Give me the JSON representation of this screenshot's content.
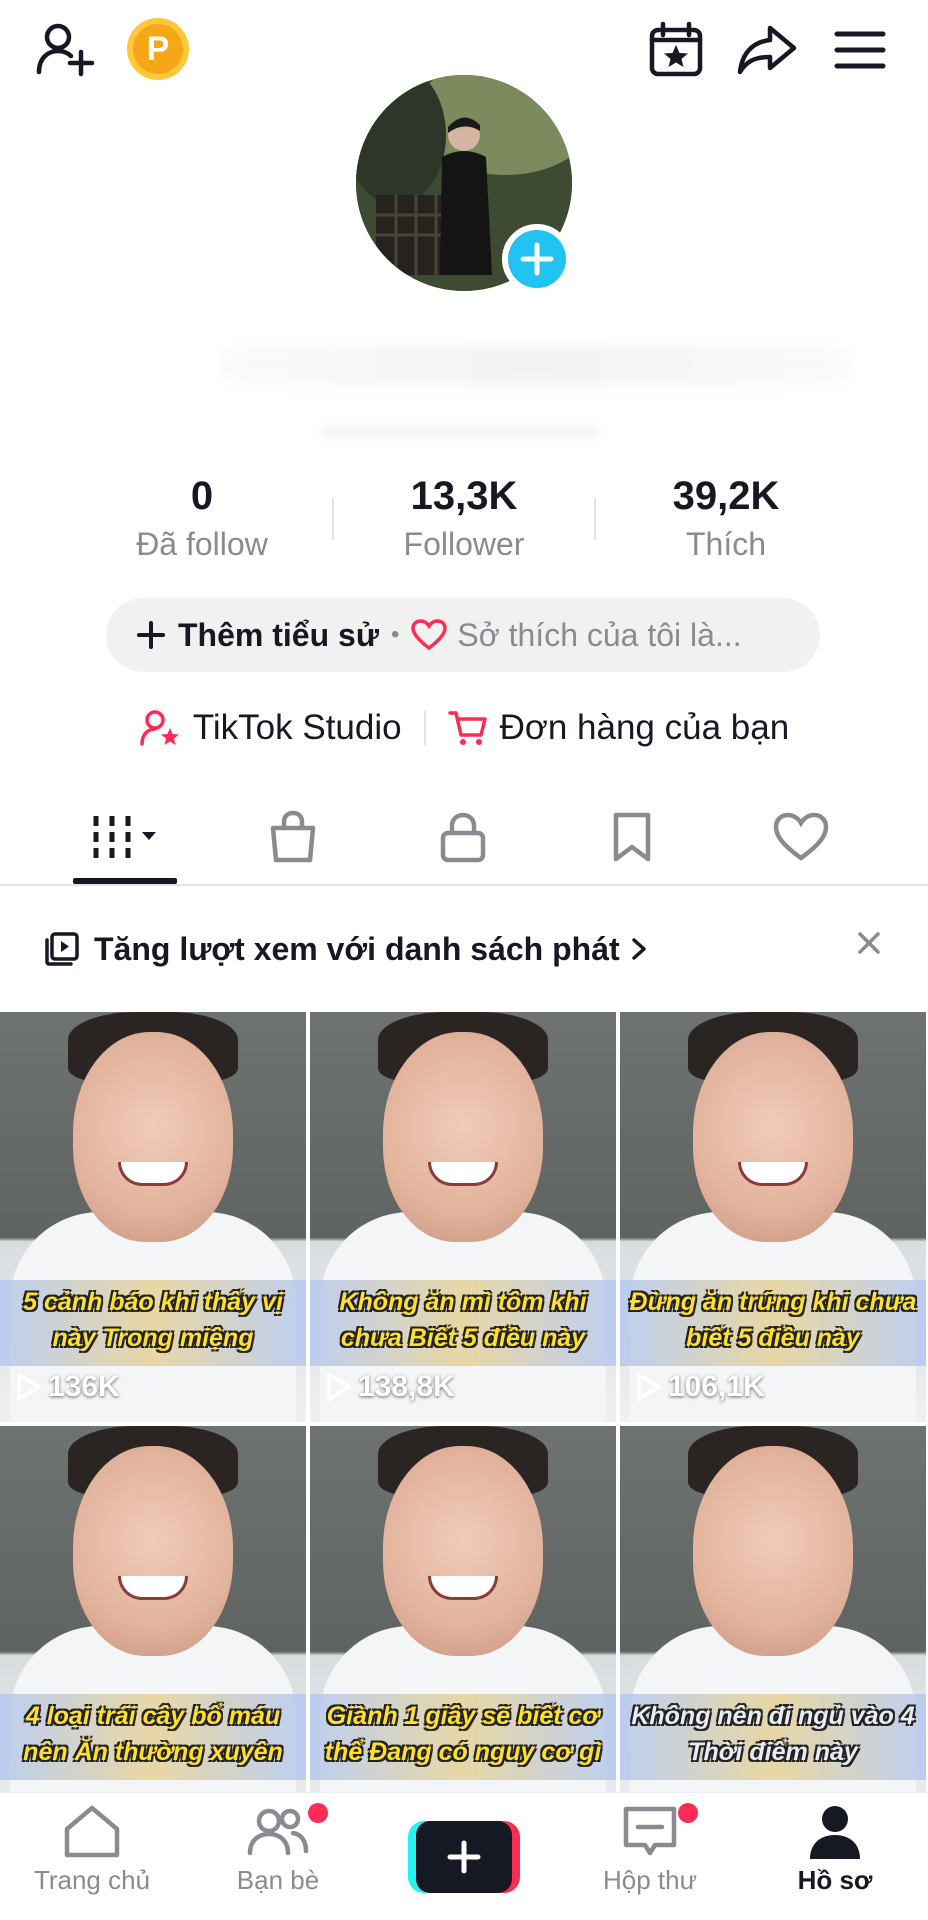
{
  "stats": [
    {
      "value": "0",
      "label": "Đã follow"
    },
    {
      "value": "13,3K",
      "label": "Follower"
    },
    {
      "value": "39,2K",
      "label": "Thích"
    }
  ],
  "bio": {
    "add_label": "Thêm tiểu sử",
    "hint": "Sở thích của tôi là..."
  },
  "links": {
    "studio": "TikTok Studio",
    "orders": "Đơn hàng của bạn"
  },
  "coin_label": "P",
  "playlist_banner": {
    "text": "Tăng lượt xem với danh sách phát"
  },
  "videos": [
    {
      "caption": "5 cảnh báo khi thấy vị này Trong miệng",
      "views": "136K"
    },
    {
      "caption": "Không ăn mì tôm khi chưa Biết 5 điều này",
      "views": "138,8K"
    },
    {
      "caption": "Đừng ăn trứng khi chưa biết 5 điều này",
      "views": "106,1K"
    },
    {
      "caption": "4 loại trái cây bổ máu nên Ăn thường xuyên",
      "views": ""
    },
    {
      "caption": "Giành 1 giây sẽ biết cơ thể Đang có nguy cơ gì",
      "views": ""
    },
    {
      "caption": "Không nên đi ngủ vào 4 Thời điểm này",
      "views": ""
    }
  ],
  "nav": {
    "home": "Trang chủ",
    "friends": "Bạn bè",
    "inbox": "Hộp thư",
    "profile": "Hồ sơ"
  },
  "colors": {
    "accent_red": "#fe2c55",
    "accent_cyan": "#25f4ee",
    "avatar_plus": "#20c3f2",
    "coin": "#f6a718"
  }
}
